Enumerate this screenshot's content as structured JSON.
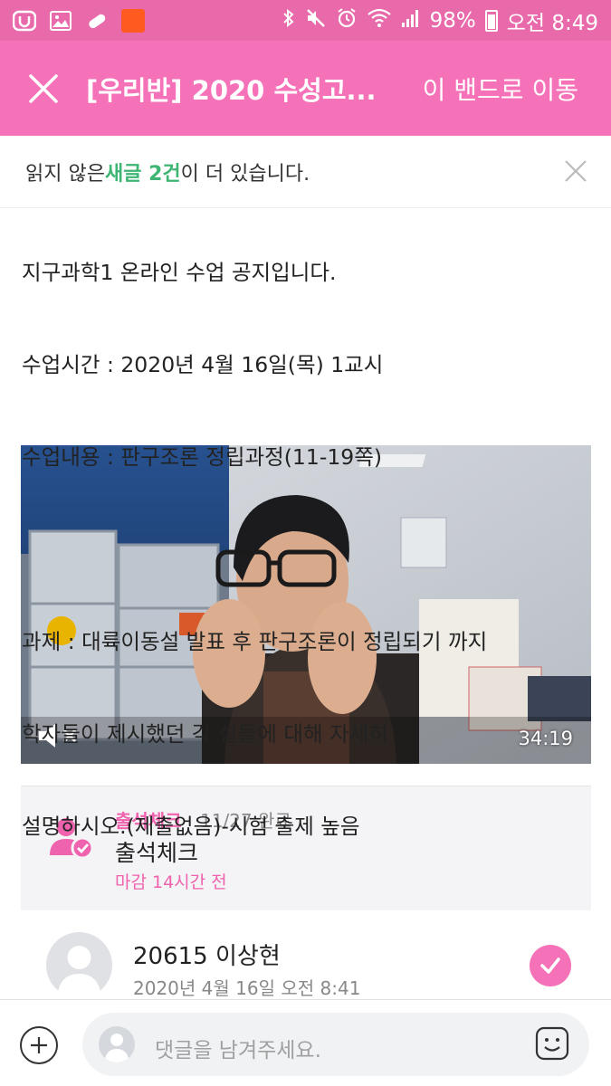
{
  "status_bar": {
    "battery": "98%",
    "time": "오전 8:49"
  },
  "app_bar": {
    "title": "[우리반] 2020 수성고...",
    "move_button": "이 밴드로 이동"
  },
  "notice": {
    "prefix": "읽지 않은 ",
    "highlight": "새글 2건",
    "suffix": "이 더 있습니다."
  },
  "post": {
    "lines": [
      "지구과학1 온라인 수업 공지입니다.",
      "수업시간 : 2020년 4월 16일(목) 1교시",
      "수업내용 : 판구조론 정립과정(11-19쪽)",
      "",
      "과제 : 대륙이동설 발표 후 판구조론이 정립되기 까지",
      "학자들이 제시했던 각 설들에 대해 자세히",
      "설명하시오.(제출없음)-시험 출제 높음"
    ]
  },
  "video": {
    "duration": "34:19"
  },
  "attendance": {
    "label": "출석체크",
    "count": "11/27 완료",
    "title": "출석체크",
    "deadline": "마감 14시간 전"
  },
  "comment": {
    "author": "20615 이상현",
    "time": "2020년 4월 16일 오전 8:41"
  },
  "input": {
    "placeholder": "댓글을 남겨주세요."
  },
  "colors": {
    "status_bar": "#e86aab",
    "app_bar": "#f571b8",
    "highlight_green": "#3fb573",
    "accent_pink": "#ef62ad"
  }
}
